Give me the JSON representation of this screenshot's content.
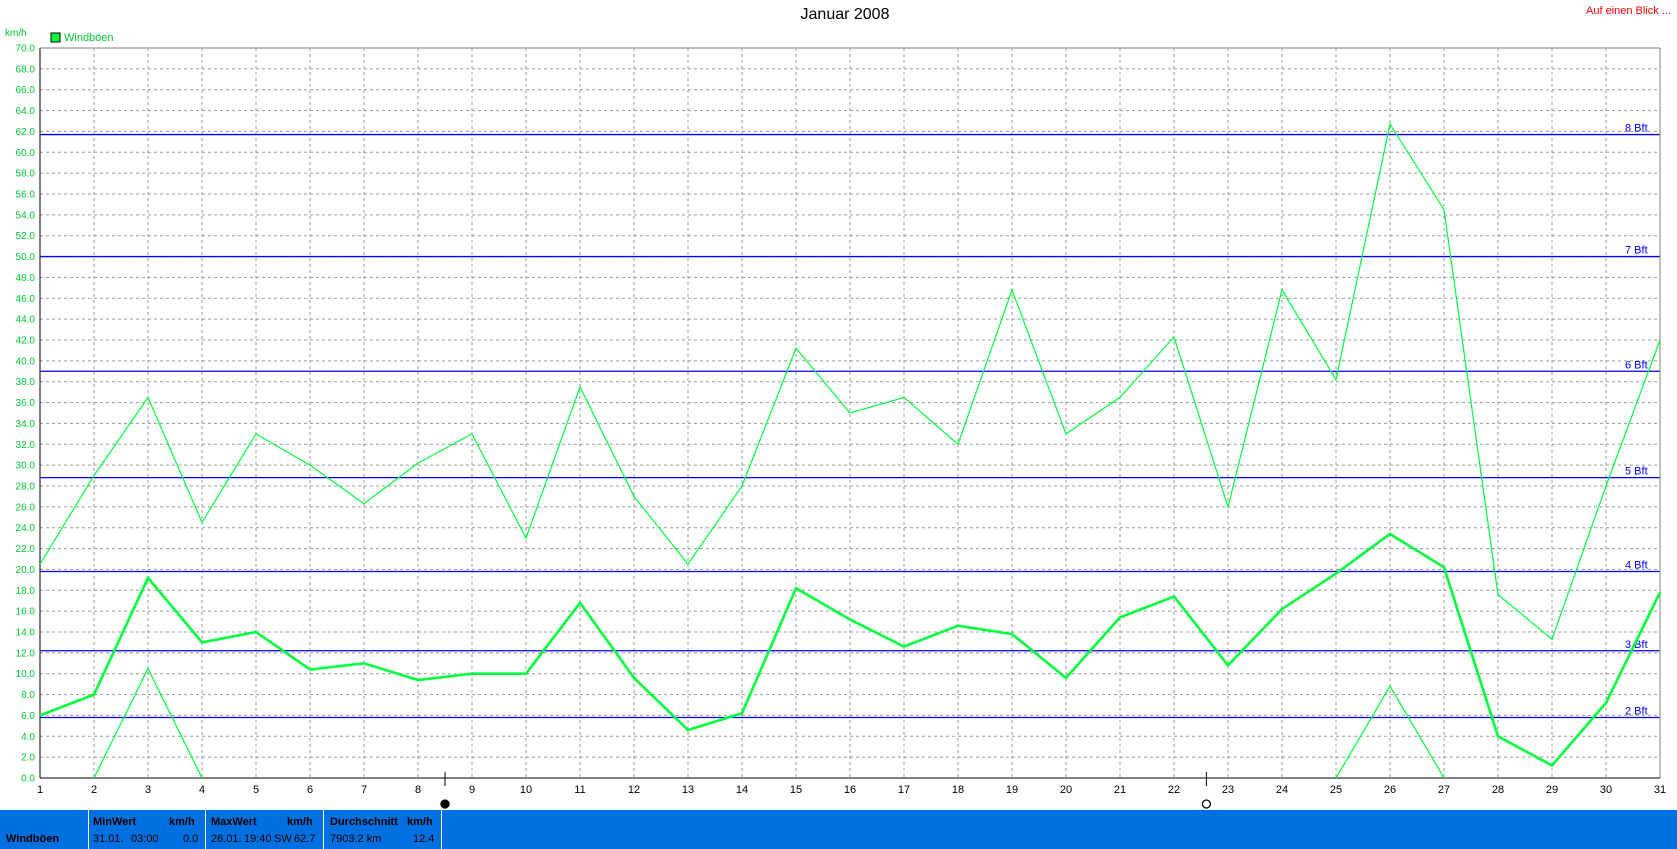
{
  "title": "Januar 2008",
  "top_right_link": "Auf einen Blick ...",
  "colors": {
    "series": "#00ff3c",
    "grid": "#9a9a9a",
    "beaufort": "#0000ff",
    "ytick": "#00c832",
    "footer_bg": "#0070e0"
  },
  "chart_data": {
    "type": "line",
    "title": "Januar 2008",
    "ylabel": "km/h",
    "ylim": [
      0,
      70
    ],
    "ytick_step": 2,
    "xlim": [
      1,
      31
    ],
    "x": [
      1,
      2,
      3,
      4,
      5,
      6,
      7,
      8,
      9,
      10,
      11,
      12,
      13,
      14,
      15,
      16,
      17,
      18,
      19,
      20,
      21,
      22,
      23,
      24,
      25,
      26,
      27,
      28,
      29,
      30,
      31
    ],
    "legend": {
      "label": "Windböen",
      "placement": "top-left"
    },
    "grid": true,
    "series": [
      {
        "name": "Windböen",
        "role": "upper",
        "values": [
          20.5,
          29.0,
          36.5,
          24.5,
          33.0,
          30.0,
          26.3,
          30.2,
          33.0,
          23.0,
          37.5,
          27.0,
          20.5,
          28.0,
          41.2,
          35.0,
          36.5,
          32.0,
          46.8,
          33.0,
          36.5,
          42.3,
          26.0,
          46.8,
          38.2,
          62.7,
          54.5,
          17.6,
          13.3,
          28.0,
          42.0
        ]
      },
      {
        "name": "Windböen",
        "role": "average",
        "values": [
          6.0,
          8.0,
          19.2,
          13.0,
          14.0,
          10.4,
          11.0,
          9.4,
          10.0,
          10.0,
          16.8,
          9.6,
          4.6,
          6.2,
          18.2,
          15.2,
          12.6,
          14.6,
          13.8,
          9.6,
          15.4,
          17.4,
          10.8,
          16.2,
          19.6,
          23.4,
          20.2,
          4.0,
          1.2,
          7.2,
          17.8
        ]
      },
      {
        "name": "Windböen",
        "role": "lower",
        "values": [
          null,
          0.0,
          10.5,
          0.0,
          null,
          null,
          null,
          null,
          null,
          null,
          null,
          null,
          null,
          null,
          null,
          null,
          null,
          null,
          null,
          null,
          null,
          null,
          null,
          null,
          0.0,
          8.8,
          0.0,
          null,
          null,
          null,
          null
        ]
      }
    ],
    "reference_lines": [
      {
        "label": "2 Bft",
        "value": 5.8
      },
      {
        "label": "3 Bft",
        "value": 12.2
      },
      {
        "label": "4 Bft",
        "value": 19.8
      },
      {
        "label": "5 Bft",
        "value": 28.8
      },
      {
        "label": "6 Bft",
        "value": 39.0
      },
      {
        "label": "7 Bft",
        "value": 50.0
      },
      {
        "label": "8 Bft",
        "value": 61.7
      }
    ],
    "markers": [
      {
        "x": 8.5,
        "symbol": "filled-circle"
      },
      {
        "x": 22.6,
        "symbol": "open-circle"
      }
    ]
  },
  "footer": {
    "series_name": "Windböen",
    "min": {
      "header": "MinWert",
      "unit": "km/h",
      "date": "31.01.",
      "time": "03:00",
      "value": "0.0"
    },
    "max": {
      "header": "MaxWert",
      "unit": "km/h",
      "date": "26.01.",
      "time": "19:40",
      "dir": "SW",
      "value": "62.7"
    },
    "avg": {
      "header": "Durchschnitt",
      "unit": "km/h",
      "distance": "7903.2 km",
      "value": "12.4"
    }
  }
}
